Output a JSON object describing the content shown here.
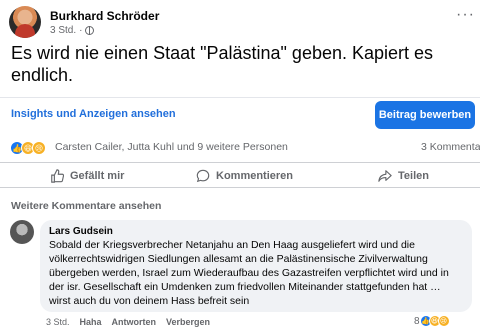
{
  "post": {
    "author": "Burkhard Schröder",
    "time": "3 Std.",
    "separator": "·",
    "more_icon": "more-horizontal-icon",
    "text": "Es wird nie einen Staat \"Palästina\" geben. Kapiert es endlich."
  },
  "insights": {
    "link_label": "Insights und Anzeigen ansehen",
    "boost_label": "Beitrag bewerben",
    "boost_color": "#1b74e4"
  },
  "reactions": {
    "icons": [
      "like-icon",
      "haha-icon",
      "sad-icon"
    ],
    "reactors": "Carsten Cailer, Jutta Kuhl und 9 weitere Personen",
    "comments_count": "3 Kommentare"
  },
  "actions": {
    "like": "Gefällt mir",
    "comment": "Kommentieren",
    "share": "Teilen"
  },
  "more_comments": "Weitere Kommentare ansehen",
  "comment": {
    "author": "Lars Gudsein",
    "text": "Sobald der Kriegsverbrecher Netanjahu an Den Haag ausgeliefert wird und die völkerrechtswidrigen Siedlungen allesamt an die Palästinensische Zivilverwaltung übergeben werden, Israel zum Wiederaufbau des Gazastreifen verpflichtet wird und in der isr. Gesellschaft ein Umdenken zum friedvollen Miteinander stattgefunden hat … wirst auch du von deinem Hass befreit sein",
    "time": "3 Std.",
    "haha": "Haha",
    "reply": "Antworten",
    "hide": "Verbergen",
    "reaction_count": "8"
  }
}
